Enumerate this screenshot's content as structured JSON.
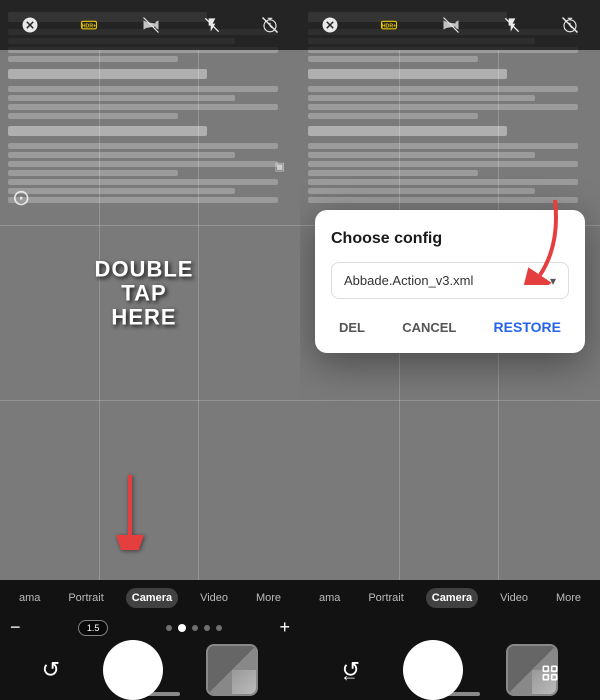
{
  "left_panel": {
    "toolbar_icons": [
      "timer-off-icon",
      "hdr-plus-icon",
      "panorama-off-icon",
      "flash-icon",
      "timer-icon",
      "hdr-plus-icon2",
      "panorama-off-icon2",
      "temp-icon",
      "flash-off-icon"
    ],
    "hdr_label": "HDR+",
    "double_tap_line1": "DOUBLE",
    "double_tap_line2": "TAP",
    "double_tap_line3": "HERE",
    "zoom_level": "1.5",
    "modes": [
      "ama",
      "Portrait",
      "Camera",
      "Video",
      "More"
    ],
    "active_mode_index": 2,
    "zoom_minus": "−",
    "zoom_plus": "+"
  },
  "right_panel": {
    "toolbar_icons": [
      "timer-off-icon",
      "hdr-plus-icon",
      "panorama-off-icon",
      "flash-icon",
      "timer-icon",
      "hdr-plus-icon2",
      "panorama-off-icon2",
      "temp-icon",
      "flash-off-icon"
    ],
    "hdr_label": "HDR+",
    "modes": [
      "ama",
      "Portrait",
      "Camera",
      "Video",
      "More"
    ],
    "active_mode_index": 2,
    "dialog": {
      "title": "Choose config",
      "select_value": "Abbade.Action_v3.xml",
      "btn_del": "DEL",
      "btn_cancel": "CANCEL",
      "btn_restore": "RESTORE"
    }
  }
}
